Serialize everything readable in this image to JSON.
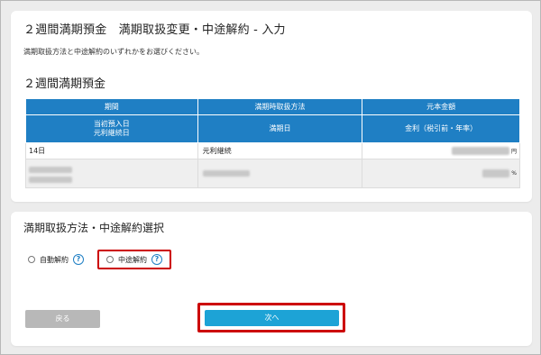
{
  "page": {
    "title": "２週間満期預金　満期取扱変更・中途解約 - 入力",
    "instruction": "満期取扱方法と中途解約のいずれかをお選びください。",
    "section_title": "２週間満期預金"
  },
  "table": {
    "headers_row1": [
      "期間",
      "満期時取扱方法",
      "元本金額"
    ],
    "headers_row2": [
      "当初預入日\n元利継続日",
      "満期日",
      "金利（税引前・年率）"
    ],
    "row1": {
      "period": "14日",
      "method": "元利継続",
      "amount_unit": "円"
    },
    "row2": {
      "rate_unit": "%"
    }
  },
  "selection": {
    "title": "満期取扱方法・中途解約選択",
    "options": [
      {
        "label": "自動解約",
        "help": "?"
      },
      {
        "label": "中途解約",
        "help": "?"
      }
    ]
  },
  "buttons": {
    "back_label": "戻る",
    "next_label": "次へ"
  },
  "colors": {
    "header_blue": "#1f7fc4",
    "next_button": "#1da3d6",
    "highlight_red": "#cc0000",
    "back_button": "#b8b8b8"
  }
}
